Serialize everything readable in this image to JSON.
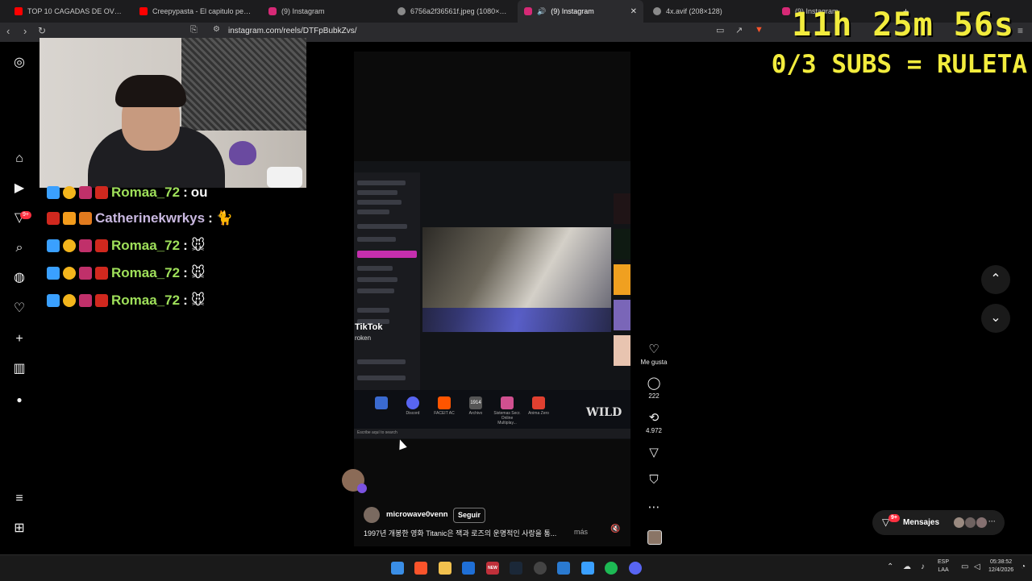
{
  "browser": {
    "tabs": [
      {
        "title": "TOP 10 CAGADAS DE OVEJA FREE F",
        "color": "#ff0000"
      },
      {
        "title": "Creepypasta - El capitulo perdido d",
        "color": "#ff0000"
      },
      {
        "title": "(9) Instagram",
        "color": "#d62976"
      },
      {
        "title": "6756a2f36561f.jpeg (1080×486)",
        "color": "#8a8a8a"
      },
      {
        "title": "(9) Instagram",
        "color": "#d62976"
      },
      {
        "title": "4x.avif (208×128)",
        "color": "#8a8a8a"
      },
      {
        "title": "(9) Instagram",
        "color": "#d62976"
      }
    ],
    "tab_close": "✕",
    "new_tab": "+",
    "url": "instagram.com/reels/DTFpBubkZvs/"
  },
  "overlay": {
    "timer": "11h 25m 56s",
    "subs": "0/3 SUBS = RULETA"
  },
  "sidebar": {
    "badges": {
      "notifications": "9+"
    }
  },
  "chat": {
    "messages": [
      {
        "user": "Romaa_72",
        "text": "ou",
        "color": "green"
      },
      {
        "user": "Catherinekwrkys",
        "text": "🐈",
        "color": "purple"
      },
      {
        "user": "Romaa_72",
        "text": "🐭",
        "color": "green"
      },
      {
        "user": "Romaa_72",
        "text": "🐭",
        "color": "green"
      },
      {
        "user": "Romaa_72",
        "text": "🐭",
        "color": "green"
      }
    ],
    "separator": ":"
  },
  "reel": {
    "tiktok_label": "TikTok",
    "tiktok_sub": "roken",
    "mini_search": "Escribe aquí to search",
    "desktop_icons": [
      {
        "label": "",
        "color": "#3a6ad0"
      },
      {
        "label": "Discord",
        "color": "#5865f2"
      },
      {
        "label": "FACEIT AC",
        "color": "#ff5500"
      },
      {
        "label": "Archivo",
        "color": "#555"
      },
      {
        "label": "Sistemas Secr. Online Multiplay...",
        "color": "#d05090"
      },
      {
        "label": "Anima Zero",
        "color": "#e04030"
      }
    ],
    "video_text": "1914",
    "video_text2": "WILD",
    "username": "microwave0venn",
    "follow": "Seguir",
    "caption": "1997년 개봉한 영화 Titanic은 잭과 로즈의 운명적인 사랑을 통...",
    "more": "más",
    "actions": {
      "like_label": "Me gusta",
      "comments": "222",
      "reposts": "4.972"
    }
  },
  "messages_pill": {
    "label": "Mensajes",
    "badge": "9+",
    "more": "···"
  },
  "taskbar": {
    "lang_line1": "ESP",
    "lang_line2": "LAA",
    "time": "05:38:52",
    "date": "12/4/2026",
    "mail_badge": "NEW"
  }
}
